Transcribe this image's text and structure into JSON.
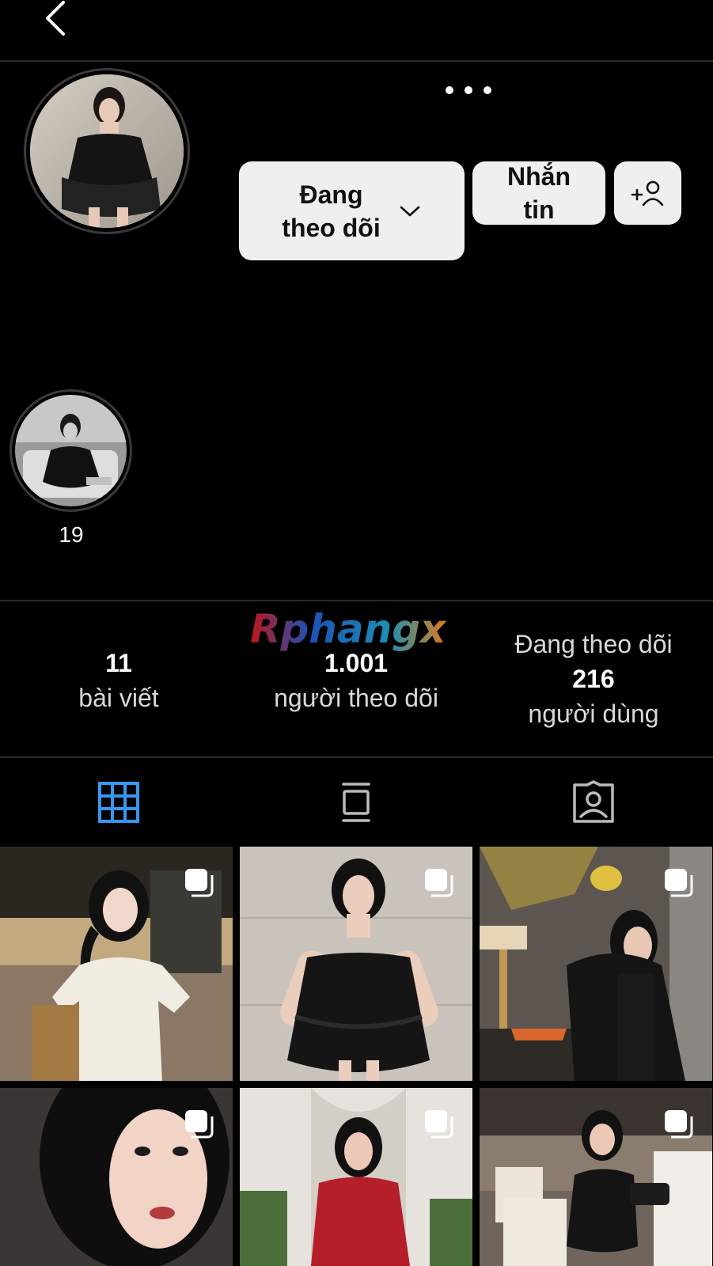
{
  "header": {
    "back_icon": "chevron-left-icon",
    "more_icon": "ellipsis-icon"
  },
  "profile": {
    "avatar_icon": "profile-photo",
    "following_button": {
      "label_line1": "Đang",
      "label_line2": "theo dõi",
      "icon": "chevron-down-icon"
    },
    "message_button": {
      "label_line1": "Nhắn",
      "label_line2": "tin"
    },
    "add_user_icon": "add-person-icon"
  },
  "highlight": {
    "label": "19"
  },
  "watermark": "Rphangx",
  "stats": {
    "posts": {
      "value": "11",
      "label": "bài viết"
    },
    "followers": {
      "value": "1.001",
      "label": "người theo dõi"
    },
    "following": {
      "top": "Đang theo dõi",
      "value": "216",
      "label": "người dùng"
    }
  },
  "tabs": [
    {
      "icon": "grid-icon",
      "active": true,
      "color": "#3897f0"
    },
    {
      "icon": "reels-feed-icon",
      "active": false
    },
    {
      "icon": "tagged-icon",
      "active": false
    }
  ],
  "colors": {
    "background": "#000000",
    "button_bg": "#efefef",
    "accent": "#3897f0"
  }
}
